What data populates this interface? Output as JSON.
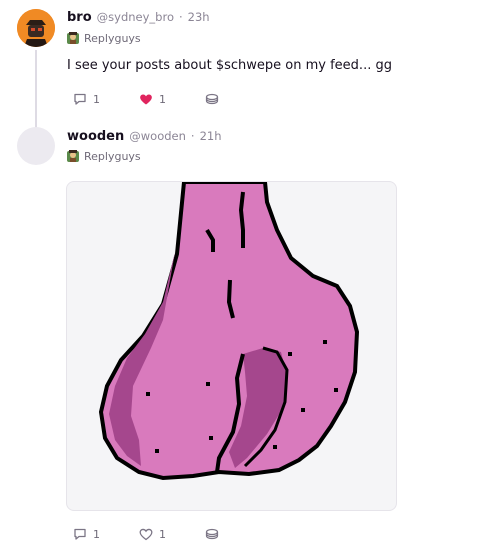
{
  "posts": [
    {
      "author_name": "bro",
      "author_handle": "@sydney_bro",
      "separator": "·",
      "timestamp": "23h",
      "channel": "Replyguys",
      "text": "I see your posts about $schwepe on my feed... gg",
      "reply_count": "1",
      "like_count": "1",
      "liked": true
    },
    {
      "author_name": "wooden",
      "author_handle": "@wooden",
      "separator": "·",
      "timestamp": "21h",
      "channel": "Replyguys",
      "reply_count": "1",
      "like_count": "1",
      "liked": false
    }
  ],
  "colors": {
    "liked_heart": "#e0245e",
    "icon_gray": "#7b7585",
    "avatar_orange": "#f08a24",
    "image_pink": "#d475bd",
    "image_dark_pink": "#a5478d"
  },
  "icons": [
    "reply-icon",
    "heart-icon",
    "coin-stack-icon",
    "channel-icon",
    "avatar-icon"
  ]
}
